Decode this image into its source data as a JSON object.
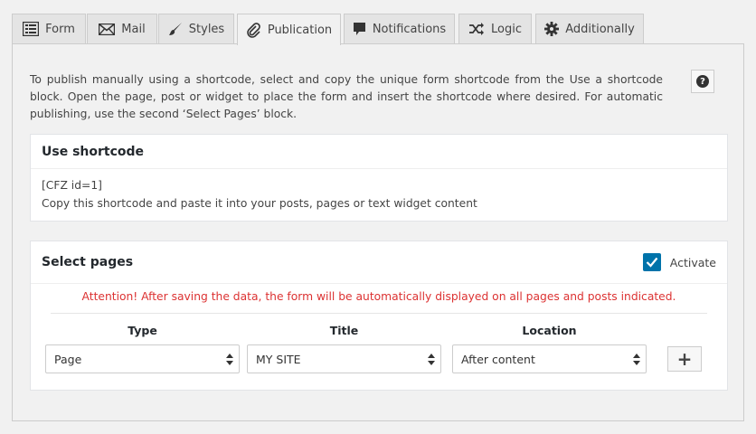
{
  "tabs": [
    {
      "label": "Form",
      "icon": "list-icon"
    },
    {
      "label": "Mail",
      "icon": "envelope-icon"
    },
    {
      "label": "Styles",
      "icon": "brush-icon"
    },
    {
      "label": "Publication",
      "icon": "paperclip-icon",
      "active": true
    },
    {
      "label": "Notifications",
      "icon": "speech-bubble-icon"
    },
    {
      "label": "Logic",
      "icon": "shuffle-icon"
    },
    {
      "label": "Additionally",
      "icon": "gear-icon"
    }
  ],
  "intro": "To publish manually using a shortcode, select and copy the unique form shortcode from the Use a shortcode block. Open the page, post or widget to place the form and insert the shortcode where desired. For automatic publishing, use the second ‘Select Pages’ block.",
  "help_label": "?",
  "use_shortcode": {
    "title": "Use shortcode",
    "code": "[CFZ id=1]",
    "hint": "Copy this shortcode and paste it into your posts, pages or text widget content"
  },
  "select_pages": {
    "title": "Select pages",
    "activate_label": "Activate",
    "activated": true,
    "attention": "Attention! After saving the data, the form will be automatically displayed on all pages and posts indicated.",
    "columns": {
      "type": "Type",
      "title": "Title",
      "location": "Location"
    },
    "row": {
      "type": "Page",
      "title": "MY SITE",
      "location": "After content"
    },
    "add_label": "+"
  },
  "colors": {
    "accent": "#0073aa",
    "attention": "#dc3232"
  }
}
